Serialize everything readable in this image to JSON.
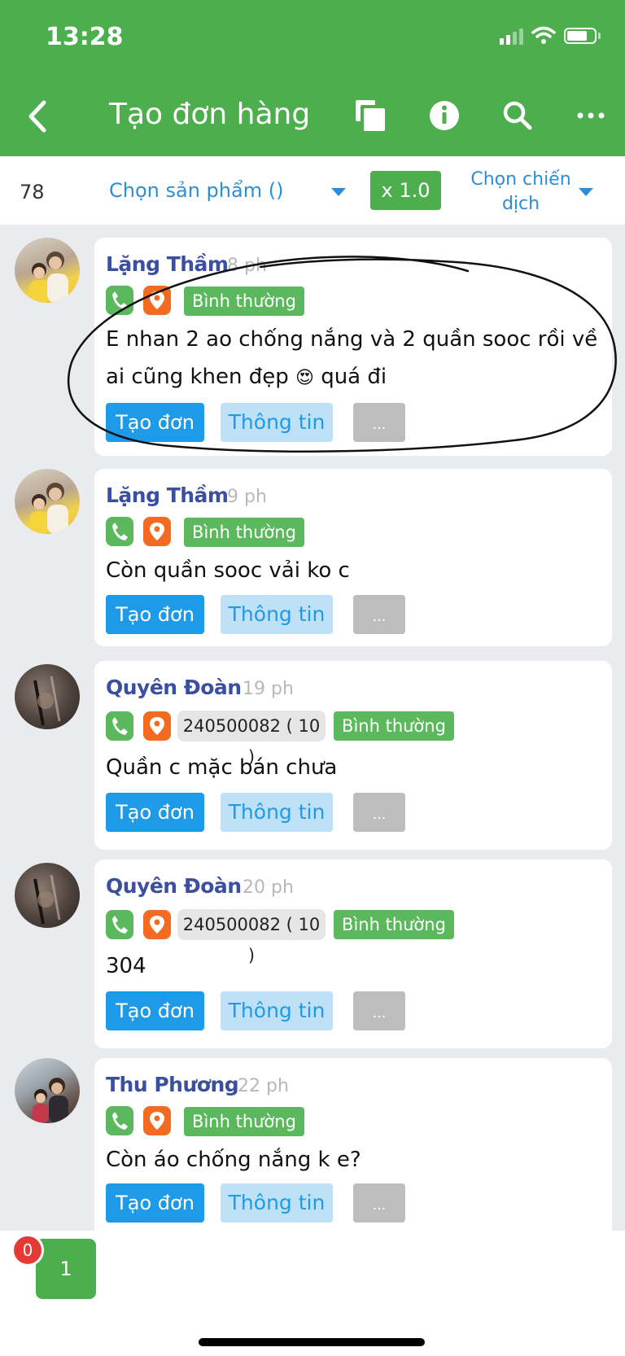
{
  "status": {
    "time": "13:28"
  },
  "header": {
    "title": "Tạo đơn hàng"
  },
  "icons": {
    "back": "chevron-left-icon",
    "copy": "copy-icon",
    "info": "info-icon",
    "search": "search-icon",
    "more": "more-horizontal-icon"
  },
  "subbar": {
    "count": "78",
    "product_select": "Chọn sản phẩm ()",
    "multiplier": "x 1.0",
    "campaign_select": "Chọn chiến dịch"
  },
  "colors": {
    "primary": "#4cae4c",
    "link": "#1e9be8",
    "name": "#3b4fa0",
    "pin": "#f26b21"
  },
  "messages": [
    {
      "name": "Lặng Thầm",
      "time": "8 ph",
      "status": "Bình thường",
      "text_line1": "E nhan 2 ao chống nắng và 2 quần sooc  rồi về",
      "text_line2_a": "ai cũng khen đẹp",
      "emoji": "😍",
      "text_line2_b": "quá đi",
      "create": "Tạo đơn",
      "info": "Thông tin",
      "more": "..."
    },
    {
      "name": "Lặng Thầm",
      "time": "9 ph",
      "status": "Bình thường",
      "text": "Còn quần sooc vải ko c",
      "create": "Tạo đơn",
      "info": "Thông tin",
      "more": "..."
    },
    {
      "name": "Quyên Đoàn",
      "time": "19 ph",
      "order": "240500082 ( 10 )",
      "status": "Bình thường",
      "text": "Quần c mặc bán chưa",
      "create": "Tạo đơn",
      "info": "Thông tin",
      "more": "..."
    },
    {
      "name": "Quyên Đoàn",
      "time": "20 ph",
      "order": "240500082 ( 10 )",
      "status": "Bình thường",
      "text": "304",
      "create": "Tạo đơn",
      "info": "Thông tin",
      "more": "..."
    },
    {
      "name": "Thu Phương",
      "time": "22 ph",
      "status": "Bình thường",
      "text": "Còn áo chống nắng k e?",
      "create": "Tạo đơn",
      "info": "Thông tin",
      "more": "..."
    }
  ],
  "bottom": {
    "badge": "0",
    "tab": "1"
  }
}
